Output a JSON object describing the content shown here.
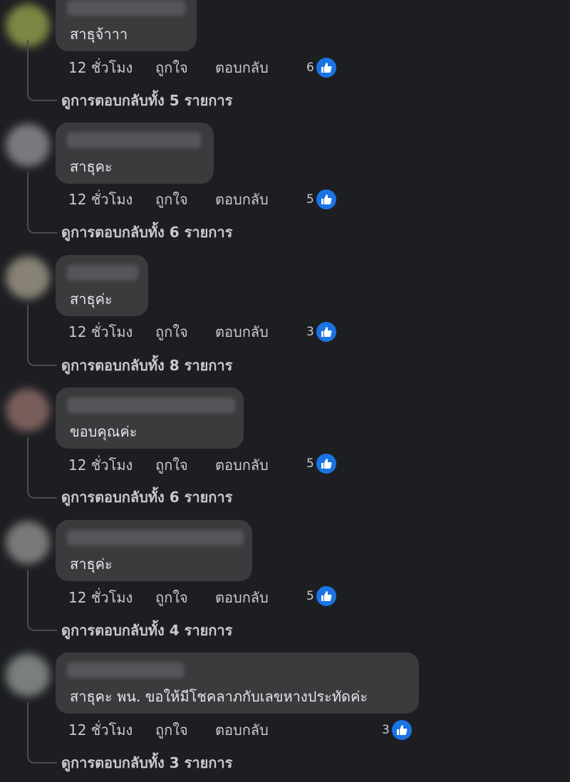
{
  "colors": {
    "background": "#1d1e22",
    "bubble": "#3a3b3c",
    "text": "#e4e6eb",
    "muted": "#c8cacf",
    "like_blue": "#1b74e4"
  },
  "comments": [
    {
      "text": "สาธุจ้าาา",
      "time": "12 ชั่วโมง",
      "like_label": "ถูกใจ",
      "reply_label": "ตอบกลับ",
      "reaction_count": "6",
      "view_replies": "ดูการตอบกลับทั้ง 5 รายการ",
      "avatar_color": "#8e9a4a",
      "reaction_icon": "thumbs-up-icon"
    },
    {
      "text": "สาธุคะ",
      "time": "12 ชั่วโมง",
      "like_label": "ถูกใจ",
      "reply_label": "ตอบกลับ",
      "reaction_count": "5",
      "view_replies": "ดูการตอบกลับทั้ง 6 รายการ",
      "avatar_color": "#8a8a90",
      "reaction_icon": "thumbs-up-icon"
    },
    {
      "text": "สาธุค่ะ",
      "time": "12 ชั่วโมง",
      "like_label": "ถูกใจ",
      "reply_label": "ตอบกลับ",
      "reaction_count": "3",
      "view_replies": "ดูการตอบกลับทั้ง 8 รายการ",
      "avatar_color": "#9a9484",
      "reaction_icon": "thumbs-up-icon"
    },
    {
      "text": "ขอบคุณค่ะ",
      "time": "12 ชั่วโมง",
      "like_label": "ถูกใจ",
      "reply_label": "ตอบกลับ",
      "reaction_count": "5",
      "view_replies": "ดูการตอบกลับทั้ง 6 รายการ",
      "avatar_color": "#8a6a66",
      "reaction_icon": "thumbs-up-icon"
    },
    {
      "text": "สาธุค่ะ",
      "time": "12 ชั่วโมง",
      "like_label": "ถูกใจ",
      "reply_label": "ตอบกลับ",
      "reaction_count": "5",
      "view_replies": "ดูการตอบกลับทั้ง 4 รายการ",
      "avatar_color": "#8c8888",
      "reaction_icon": "thumbs-up-icon"
    },
    {
      "text": "สาธุคะ พน. ขอให้มีโชคลาภกับเลขหางประทัดค่ะ",
      "time": "12 ชั่วโมง",
      "like_label": "ถูกใจ",
      "reply_label": "ตอบกลับ",
      "reaction_count": "3",
      "view_replies": "ดูการตอบกลับทั้ง 3 รายการ",
      "avatar_color": "#8a908c",
      "reaction_icon": "thumbs-up-icon"
    }
  ]
}
